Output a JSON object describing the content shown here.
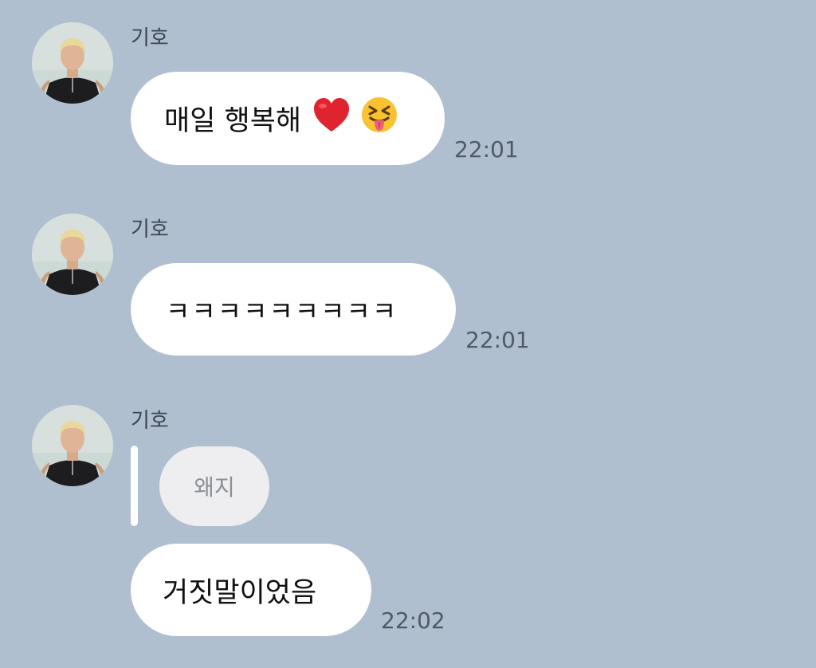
{
  "messages": [
    {
      "sender": "기호",
      "text": "매일 행복해",
      "emojis": [
        "red-heart-emoji",
        "squinting-face-with-tongue-emoji"
      ],
      "time": "22:01"
    },
    {
      "sender": "기호",
      "text": "ㅋㅋㅋㅋㅋㅋㅋㅋㅋ",
      "time": "22:01"
    },
    {
      "sender": "기호",
      "reply_to": "왜지",
      "text": "거짓말이었음",
      "time": "22:02"
    }
  ],
  "colors": {
    "background": "#b0bfcf",
    "bubble": "#ffffff",
    "reply_chip": "#eeeef0",
    "time_text": "#4f5a66"
  }
}
